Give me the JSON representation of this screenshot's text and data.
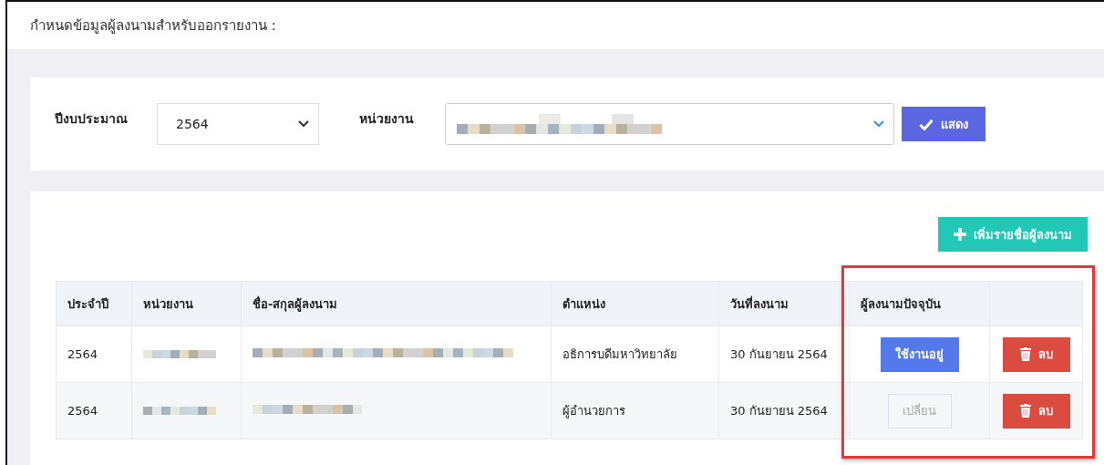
{
  "page_title": "กำหนดข้อมูลผู้ลงนามสำหรับออกรายงาน :",
  "filter": {
    "year_label": "ปีงบประมาณ",
    "year_value": "2564",
    "unit_label": "หน่วยงาน",
    "show_button": "แสดง"
  },
  "add_button": "เพิ่มรายชื่อผู้ลงนาม",
  "table": {
    "columns": [
      "ประจำปี",
      "หน่วยงาน",
      "ชื่อ-สกุลผู้ลงนาม",
      "ตำแหน่ง",
      "วันที่ลงนาม",
      "ผู้ลงนามปัจจุบัน"
    ],
    "rows": [
      {
        "year": "2564",
        "position": "อธิการบดีมหาวิทยาลัย",
        "date": "30 กันยายน 2564",
        "status_button": {
          "label": "ใช้งานอยู่",
          "selected": true
        },
        "delete_button": "ลบ"
      },
      {
        "year": "2564",
        "position": "ผู้อำนวยการ",
        "date": "30 กันยายน 2564",
        "status_button": {
          "label": "เปลี่ยน",
          "selected": false
        },
        "delete_button": "ลบ"
      }
    ]
  }
}
